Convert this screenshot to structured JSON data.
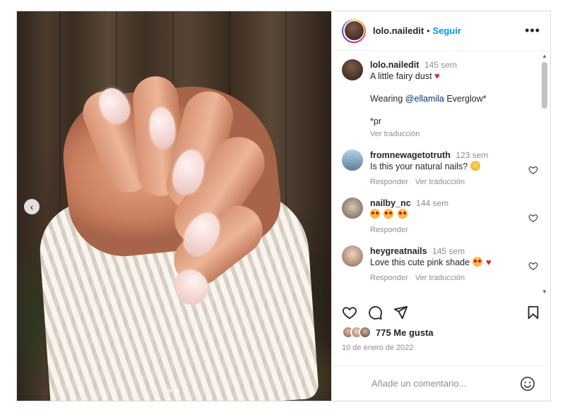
{
  "post": {
    "photo": {
      "description_icon": "photo-carousel",
      "nav_prev_glyph": "‹",
      "dots": [
        {
          "active": false
        },
        {
          "active": true
        }
      ]
    },
    "header": {
      "username": "lolo.nailedit",
      "separator": "•",
      "follow_label": "Seguir",
      "more_glyph": "•••"
    },
    "caption": {
      "username": "lolo.nailedit",
      "time": "145 sem",
      "line1": "A little fairy dust",
      "line2_prefix": "Wearing ",
      "line2_mention": "@ellamila",
      "line2_suffix": " Everglow*",
      "line3": "*pr",
      "translate": "Ver traducción"
    },
    "comments": [
      {
        "username": "fromnewagetotruth",
        "time": "123 sem",
        "text": "Is this your natural nails?",
        "reply": "Responder",
        "translate": "Ver traducción",
        "avatar_color": "#6c8fb2"
      },
      {
        "username": "nailby_nc",
        "time": "144 sem",
        "text": "",
        "reply": "Responder",
        "translate": "",
        "avatar_color": "#8a7a6a"
      },
      {
        "username": "heygreatnails",
        "time": "145 sem",
        "text": "Love this cute pink shade",
        "reply": "Responder",
        "translate": "Ver traducción",
        "avatar_color": "#c9a28e"
      }
    ],
    "likes": {
      "count_label": "775 Me gusta"
    },
    "date": "10 de enero de 2022",
    "add_comment": {
      "placeholder": "Añade un comentario..."
    },
    "colors": {
      "accent": "#0095f6",
      "text": "#262626",
      "muted": "#8e8e8e",
      "mention": "#00376b"
    }
  }
}
